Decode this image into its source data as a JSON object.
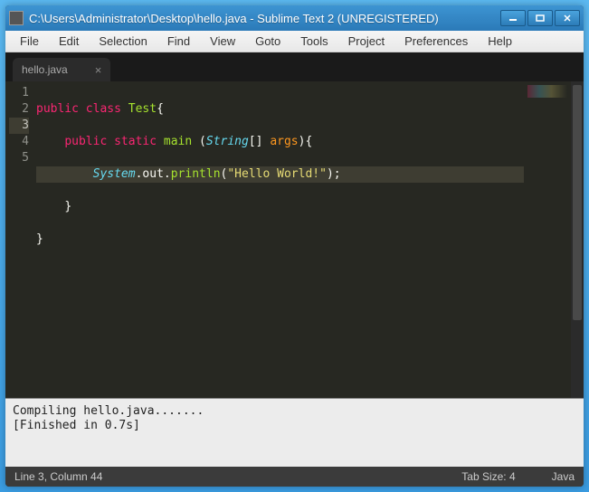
{
  "titlebar": {
    "title": "C:\\Users\\Administrator\\Desktop\\hello.java - Sublime Text 2 (UNREGISTERED)"
  },
  "menu": {
    "file": "File",
    "edit": "Edit",
    "selection": "Selection",
    "find": "Find",
    "view": "View",
    "goto": "Goto",
    "tools": "Tools",
    "project": "Project",
    "preferences": "Preferences",
    "help": "Help"
  },
  "tab": {
    "name": "hello.java"
  },
  "code": {
    "line1": {
      "kw1": "public",
      "kw2": "class",
      "name": "Test",
      "brace": "{"
    },
    "line2": {
      "kw1": "public",
      "kw2": "static",
      "fn": "main",
      "lp": "(",
      "type": "String",
      "arr": "[]",
      "arg": "args",
      "rp": ")",
      "brace": "{"
    },
    "line3": {
      "obj": "System",
      "dot1": ".",
      "out": "out",
      "dot2": ".",
      "fn": "println",
      "lp": "(",
      "str": "\"Hello World!\"",
      "rp": ")",
      "semi": ";"
    },
    "line4": {
      "brace": "}"
    },
    "line5": {
      "brace": "}"
    }
  },
  "gutter": {
    "l1": "1",
    "l2": "2",
    "l3": "3",
    "l4": "4",
    "l5": "5"
  },
  "console": {
    "line1": "Compiling hello.java.......",
    "line2": "[Finished in 0.7s]"
  },
  "status": {
    "left": "Line 3, Column 44",
    "tab_size": "Tab Size: 4",
    "lang": "Java"
  }
}
